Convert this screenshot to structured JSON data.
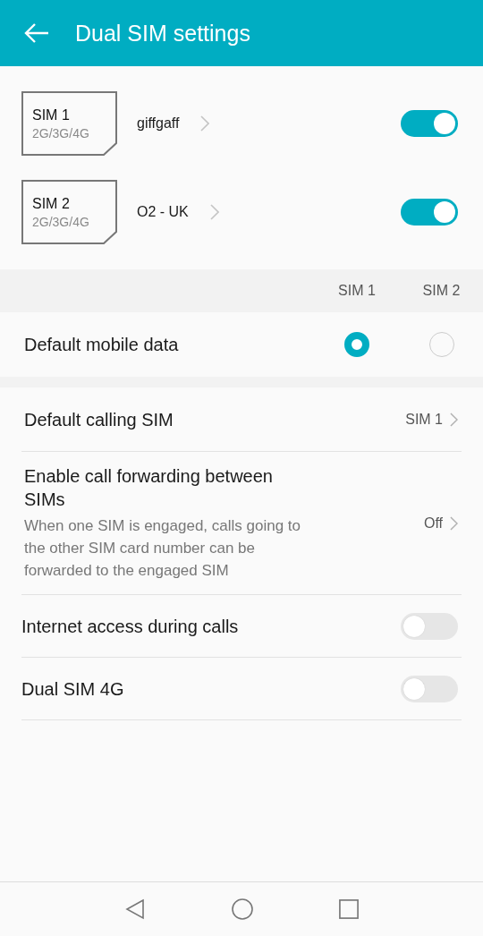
{
  "header": {
    "title": "Dual SIM settings"
  },
  "sims": [
    {
      "label": "SIM 1",
      "networks": "2G/3G/4G",
      "carrier": "giffgaff",
      "on": true
    },
    {
      "label": "SIM 2",
      "networks": "2G/3G/4G",
      "carrier": "O2 - UK",
      "on": true
    }
  ],
  "default_data": {
    "columns": [
      "SIM 1",
      "SIM 2"
    ],
    "label": "Default mobile data",
    "options": [
      {
        "selected": true
      },
      {
        "selected": false
      }
    ]
  },
  "settings": [
    {
      "kind": "value",
      "label": "Default calling SIM",
      "value": "SIM 1"
    },
    {
      "kind": "value",
      "label": "Enable call forwarding between SIMs",
      "description": "When one SIM is engaged, calls going to the other SIM card number can be forwarded to the engaged SIM",
      "value": "Off"
    },
    {
      "kind": "toggle",
      "label": "Internet access during calls",
      "on": false
    },
    {
      "kind": "toggle",
      "label": "Dual SIM 4G",
      "on": false
    }
  ]
}
